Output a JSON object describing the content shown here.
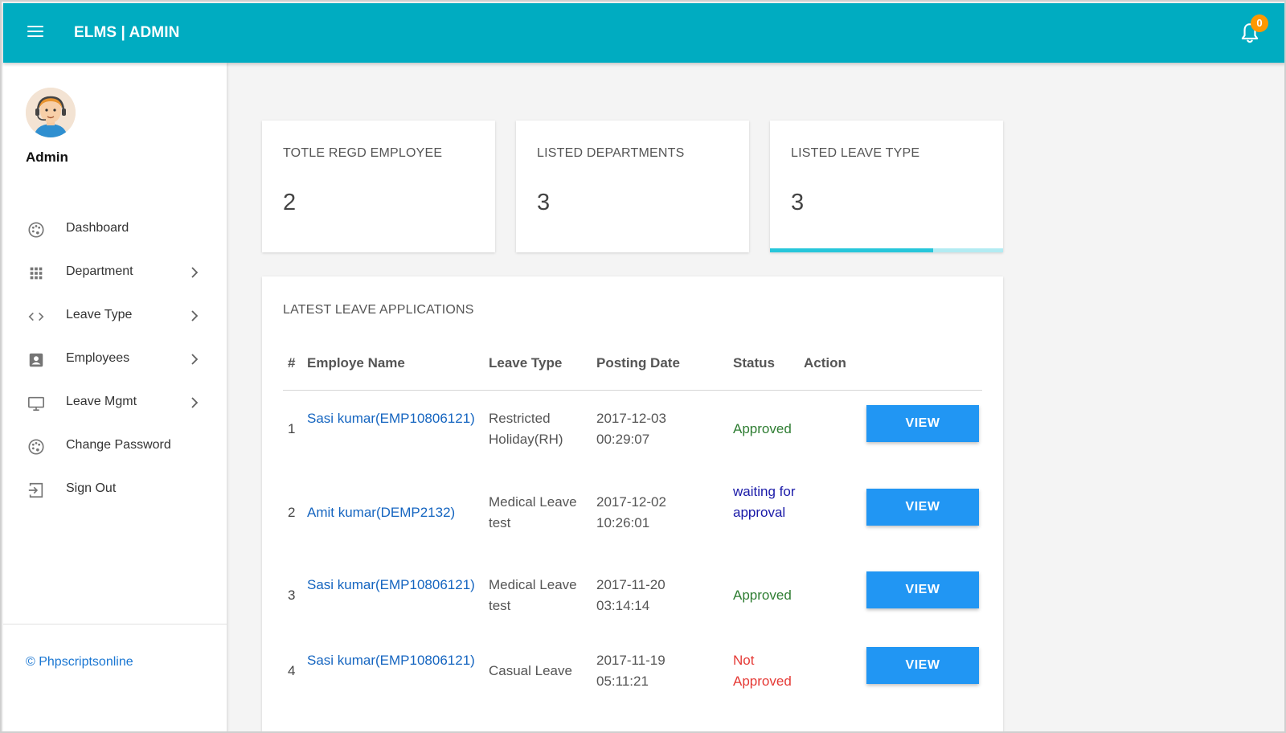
{
  "header": {
    "brand": "ELMS | ADMIN",
    "notification_count": "0",
    "colors": {
      "bar": "#00acc1",
      "badge": "#ff9800"
    }
  },
  "sidebar": {
    "user_name": "Admin",
    "items": [
      {
        "label": "Dashboard",
        "icon": "palette-icon",
        "has_submenu": false
      },
      {
        "label": "Department",
        "icon": "apps-grid-icon",
        "has_submenu": true
      },
      {
        "label": "Leave Type",
        "icon": "code-icon",
        "has_submenu": true
      },
      {
        "label": "Employees",
        "icon": "account-box-icon",
        "has_submenu": true
      },
      {
        "label": "Leave Mgmt",
        "icon": "desktop-icon",
        "has_submenu": true
      },
      {
        "label": "Change Password",
        "icon": "palette-icon",
        "has_submenu": false
      },
      {
        "label": "Sign Out",
        "icon": "sign-out-icon",
        "has_submenu": false
      }
    ],
    "footer": "© Phpscriptsonline"
  },
  "stats": [
    {
      "title": "TOTLE REGD EMPLOYEE",
      "value": "2"
    },
    {
      "title": "LISTED DEPARTMENTS",
      "value": "3"
    },
    {
      "title": "LISTED LEAVE TYPE",
      "value": "3",
      "progress_fraction": 0.7
    }
  ],
  "leave_table": {
    "title": "LATEST LEAVE APPLICATIONS",
    "headers": [
      "#",
      "Employe Name",
      "Leave Type",
      "Posting Date",
      "Status",
      "Action"
    ],
    "rows": [
      {
        "num": "1",
        "name": "Sasi kumar(EMP10806121)",
        "leave_type": "Restricted Holiday(RH)",
        "posting_date": "2017-12-03 00:29:07",
        "status": "Approved",
        "status_color": "#2e7d32",
        "action": "VIEW"
      },
      {
        "num": "2",
        "name": "Amit kumar(DEMP2132)",
        "leave_type": "Medical Leave test",
        "posting_date": "2017-12-02 10:26:01",
        "status": "waiting for approval",
        "status_color": "#1a1aa8",
        "action": "VIEW"
      },
      {
        "num": "3",
        "name": "Sasi kumar(EMP10806121)",
        "leave_type": "Medical Leave test",
        "posting_date": "2017-11-20 03:14:14",
        "status": "Approved",
        "status_color": "#2e7d32",
        "action": "VIEW"
      },
      {
        "num": "4",
        "name": "Sasi kumar(EMP10806121)",
        "leave_type": "Casual Leave",
        "posting_date": "2017-11-19 05:11:21",
        "status": "Not Approved",
        "status_color": "#e53935",
        "action": "VIEW"
      }
    ]
  }
}
